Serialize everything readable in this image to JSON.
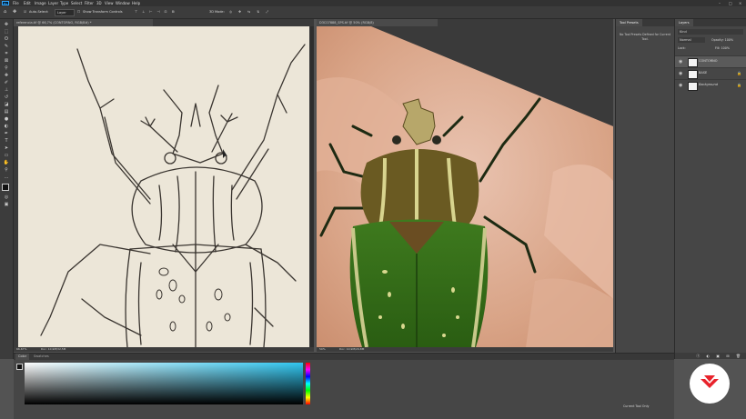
{
  "menubar": {
    "logo": "Ps",
    "items": [
      "File",
      "Edit",
      "Image",
      "Layer",
      "Type",
      "Select",
      "Filter",
      "3D",
      "View",
      "Window",
      "Help"
    ]
  },
  "options": {
    "auto_select": "Auto-Select:",
    "layer_value": "Layer",
    "show_transform": "Show Transform Controls",
    "mode_3d": "3D Mode:"
  },
  "doc1": {
    "tab": "referencia.tif @ 66,7% (CONTORNO, RGB/8#) *",
    "zoom": "66,67%",
    "size": "Doc: 10,9M/32,5M"
  },
  "doc2": {
    "tab": "D3C07888_SPS.tif @ 50% (RGB/8)",
    "zoom": "50%",
    "size": "Doc: 10,9M/29,8M"
  },
  "tool_presets": {
    "title": "Tool Presets",
    "message": "No Tool Presets Defined for Current Tool."
  },
  "layers": {
    "title": "Layers",
    "search": "Kind",
    "blend": "Normal",
    "opacity": "Opacity: 100%",
    "fill": "Fill: 100%",
    "lock": "Lock:",
    "items": [
      {
        "name": "CONTORNO"
      },
      {
        "name": "BASE"
      },
      {
        "name": "Background"
      }
    ]
  },
  "color_panel": {
    "tab_color": "Color",
    "tab_swatches": "Swatches",
    "current_tool_only": "Current Tool Only"
  },
  "colors": {
    "accent": "#31a8ff",
    "brand": "#e8232c"
  }
}
